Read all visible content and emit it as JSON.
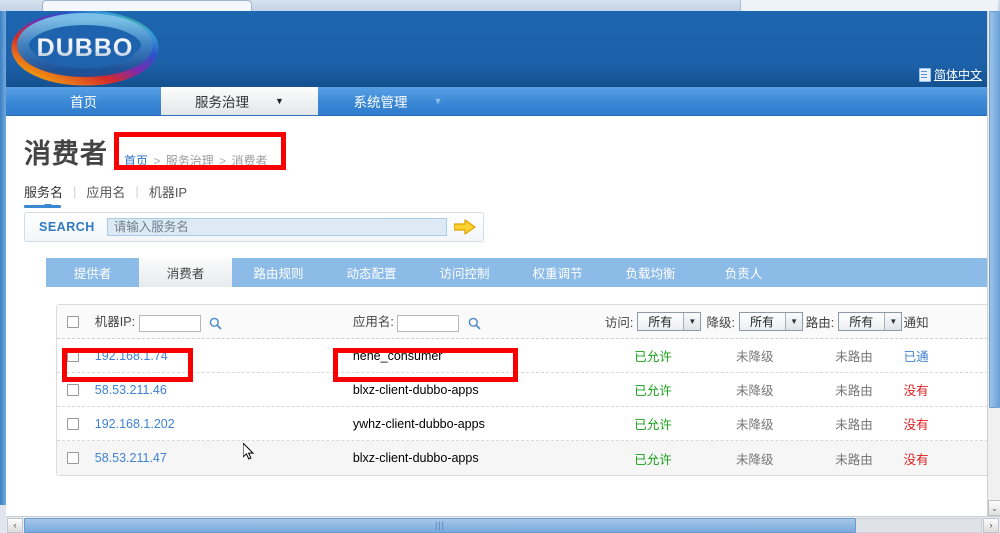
{
  "header": {
    "logo_text": "DUBBO",
    "lang_switch": "简体中文",
    "lang_icon": "document-icon"
  },
  "main_nav": [
    {
      "label": "首页",
      "active": false,
      "caret": ""
    },
    {
      "label": "服务治理",
      "active": true,
      "caret": "▼"
    },
    {
      "label": "系统管理",
      "active": false,
      "caret": "▼"
    }
  ],
  "page": {
    "title": "消费者",
    "breadcrumb": {
      "home": "首页",
      "sep1": ">",
      "level2": "服务治理",
      "sep2": ">",
      "current": "消费者"
    }
  },
  "sub_tabs": [
    {
      "label": "服务名",
      "active": true
    },
    {
      "label": "应用名",
      "active": false
    },
    {
      "label": "机器IP",
      "active": false
    }
  ],
  "search": {
    "label": "SEARCH",
    "placeholder": "请输入服务名",
    "value": "",
    "go_icon": "arrow-right-icon"
  },
  "tab_strip": [
    {
      "label": "提供者",
      "active": false
    },
    {
      "label": "消费者",
      "active": true
    },
    {
      "label": "路由规则",
      "active": false
    },
    {
      "label": "动态配置",
      "active": false
    },
    {
      "label": "访问控制",
      "active": false
    },
    {
      "label": "权重调节",
      "active": false
    },
    {
      "label": "负载均衡",
      "active": false
    },
    {
      "label": "负责人",
      "active": false
    }
  ],
  "table": {
    "filters": {
      "ip_label": "机器IP:",
      "ip_value": "",
      "app_label": "应用名:",
      "app_value": "",
      "search_icon": "magnifier-icon",
      "access_label": "访问:",
      "access_value": "所有",
      "degrade_label": "降级:",
      "degrade_value": "所有",
      "route_label": "路由:",
      "route_value": "所有",
      "notify_label": "通知"
    },
    "rows": [
      {
        "ip": "192.168.1.74",
        "app": "hehe_consumer",
        "access": "已允许",
        "degrade": "未降级",
        "route": "未路由",
        "notify": "已通",
        "notify_style": "blue"
      },
      {
        "ip": "58.53.211.46",
        "app": "blxz-client-dubbo-apps",
        "access": "已允许",
        "degrade": "未降级",
        "route": "未路由",
        "notify": "没有",
        "notify_style": "red"
      },
      {
        "ip": "192.168.1.202",
        "app": "ywhz-client-dubbo-apps",
        "access": "已允许",
        "degrade": "未降级",
        "route": "未路由",
        "notify": "没有",
        "notify_style": "red"
      },
      {
        "ip": "58.53.211.47",
        "app": "blxz-client-dubbo-apps",
        "access": "已允许",
        "degrade": "未降级",
        "route": "未路由",
        "notify": "没有",
        "notify_style": "red"
      }
    ]
  },
  "colors": {
    "brand_blue": "#1c60a8",
    "nav_blue": "#3b88d6",
    "tab_strip_blue": "#8cbbe8",
    "link_blue": "#3f82cf",
    "ok_green": "#18a018",
    "alert_red": "#e02020",
    "annotation_red": "#f80000"
  },
  "scrollbars": {
    "h_left_arrow": "‹",
    "h_right_arrow": "›",
    "h_grip": "|||",
    "v_down_arrow": "⌄"
  }
}
